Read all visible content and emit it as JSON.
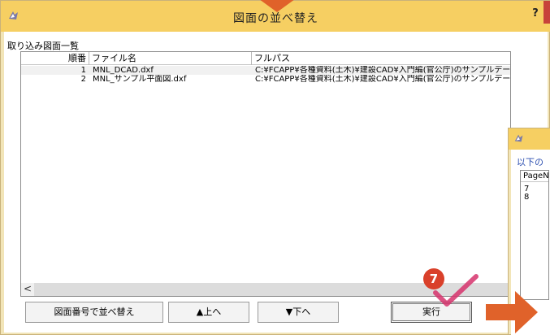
{
  "window": {
    "title": "図面の並べ替え",
    "help_label": "?"
  },
  "group": {
    "label": "取り込み図面一覧"
  },
  "list": {
    "columns": [
      "順番",
      "ファイル名",
      "フルパス"
    ],
    "rows": [
      {
        "no": "1",
        "file": "MNL_DCAD.dxf",
        "path": "C:¥FCAPP¥各種資料(土木)¥建設CAD¥入門編(官公庁)のサンプルデー"
      },
      {
        "no": "2",
        "file": "MNL_サンプル平面図.dxf",
        "path": "C:¥FCAPP¥各種資料(土木)¥建設CAD¥入門編(官公庁)のサンプルデー"
      }
    ],
    "scroll_left": "<"
  },
  "buttons": {
    "sort_label": "図面番号で並べ替え",
    "up_label": "▲上へ",
    "down_label": "▼下へ",
    "run_label": "実行"
  },
  "annotation": {
    "step_number": "7",
    "accent_color": "#d9402a"
  },
  "sub_window": {
    "label": "以下の",
    "header": "PageN",
    "rows": [
      "7",
      "8"
    ]
  },
  "colors": {
    "titlebar": "#f6cf62",
    "frame": "#f2e5b8",
    "arrow": "#e0622a"
  }
}
